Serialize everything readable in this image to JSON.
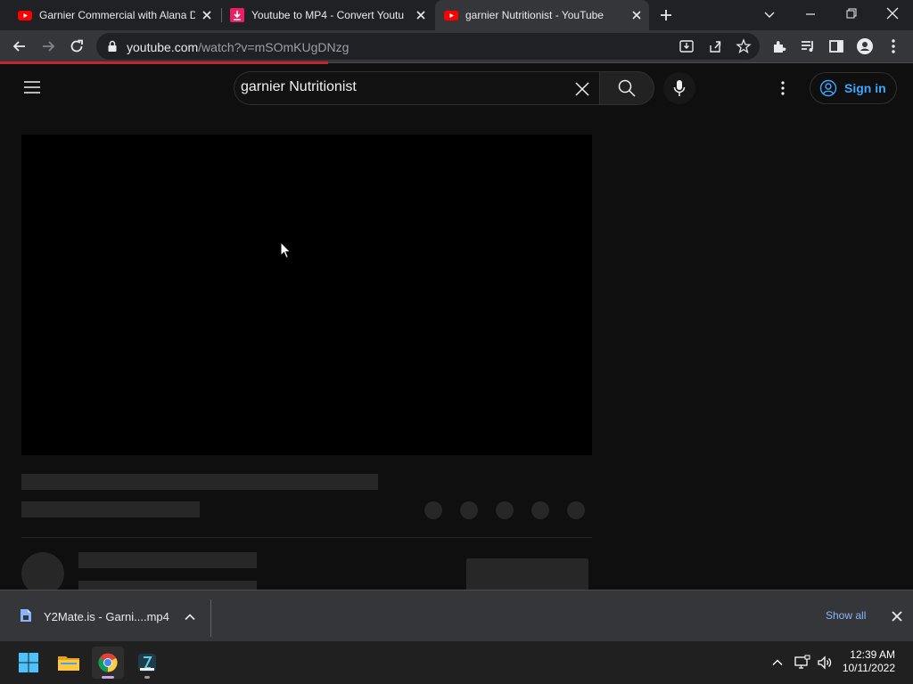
{
  "browser": {
    "tabs": [
      {
        "title": "Garnier Commercial with Alana D",
        "favicon": "youtube-icon",
        "active": false
      },
      {
        "title": "Youtube to MP4 - Convert Youtu",
        "favicon": "download-icon",
        "active": false
      },
      {
        "title": "garnier Nutritionist - YouTube",
        "favicon": "youtube-icon",
        "active": true
      }
    ],
    "url_host": "youtube.com",
    "url_path": "/watch?v=mSOmKUgDNzg"
  },
  "youtube": {
    "search_value": "garnier Nutritionist",
    "sign_in_label": "Sign in",
    "accent": "#3ea6ff",
    "logo_color": "#ff0000"
  },
  "download_shelf": {
    "file_name": "Y2Mate.is - Garni....mp4",
    "show_all_label": "Show all"
  },
  "taskbar": {
    "apps": [
      "start-icon",
      "file-explorer-icon",
      "chrome-icon",
      "app-icon"
    ],
    "time": "12:39 AM",
    "date": "10/11/2022"
  }
}
